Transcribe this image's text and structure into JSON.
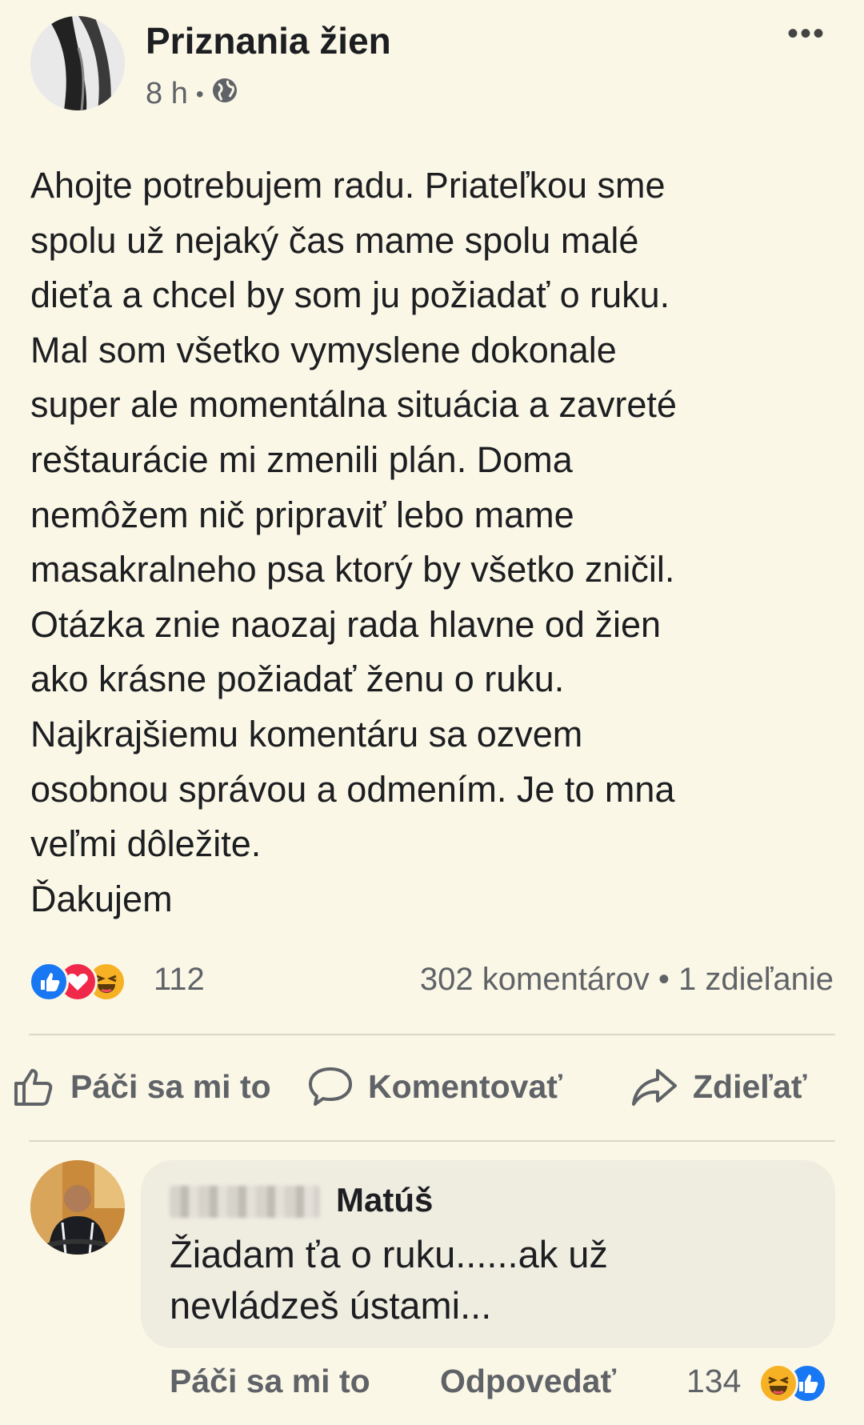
{
  "post": {
    "page_name": "Priznania žien",
    "time": "8 h",
    "separator": "•",
    "audience_icon": "globe-icon",
    "more_icon": "•••",
    "text": "Ahojte potrebujem radu. Priateľkou sme\nspolu už nejaký čas mame spolu malé\ndieťa a chcel by som ju požiadať o ruku.\nMal som všetko vymyslene dokonale\nsuper ale momentálna situácia a zavreté\nreštaurácie mi zmenili plán. Doma\nnemôžem nič pripraviť lebo mame\nmasakralneho psa ktorý by všetko zničil.\nOtázka znie naozaj rada hlavne od žien\nako krásne požiadať ženu o ruku.\nNajkrajšiemu komentáru sa ozvem\nosobnou správou a odmením. Je to mna\nveľmi dôležite.\nĎakujem"
  },
  "reactions": {
    "icons": [
      "like-icon",
      "love-icon",
      "haha-icon"
    ],
    "count": "112",
    "stats": "302 komentárov • 1 zdieľanie"
  },
  "actions": {
    "like": "Páči sa mi to",
    "comment": "Komentovať",
    "share": "Zdieľať"
  },
  "comment": {
    "author": "Matúš",
    "text": "Žiadam ťa o ruku......ak už\nnevládzeš ústami...",
    "like_label": "Páči sa mi to",
    "reply_label": "Odpovedať",
    "reaction_count": "134",
    "reaction_icons": [
      "haha-icon",
      "like-icon"
    ]
  },
  "colors": {
    "background": "#fbf7e6",
    "like_blue": "#1877f2",
    "love_red": "#f0284a",
    "haha_yellow": "#f7b125",
    "muted_text": "#5f6368"
  }
}
